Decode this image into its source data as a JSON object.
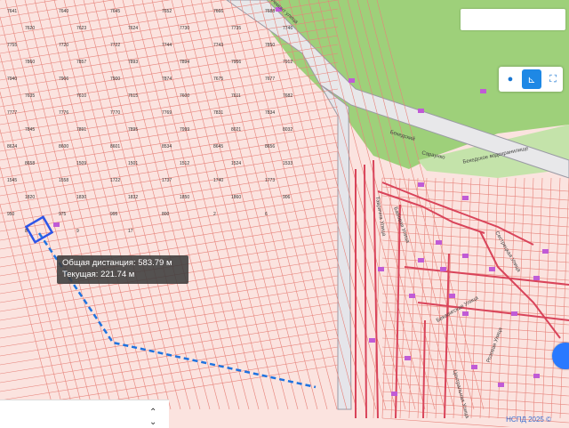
{
  "measure": {
    "total_label": "Общая дистанция: 583.79 м",
    "current_label": "Текущая: 221.74 м"
  },
  "streets": {
    "s1": "Ремонт улица",
    "s2": "Бекедский",
    "s3": "Сараунко",
    "s4": "Бекедское водохранилище",
    "s5": "Таврична Улица",
    "s6": "Сестрецкая Улица",
    "s7": "Бабовая Улица",
    "s8": "Бекаоигская Улица",
    "s9": "Розовая Улица",
    "s10": "Центральная Улица"
  },
  "parcels": [
    "7641",
    "7640",
    "7645",
    "7652",
    "7666",
    "7688",
    "7620",
    "7623",
    "7624",
    "7730",
    "7735",
    "7746",
    "7755",
    "7720",
    "7722",
    "7744",
    "7743",
    "7850",
    "7860",
    "7857",
    "7893",
    "7894",
    "7956",
    "7912",
    "7940",
    "7906",
    "7900",
    "7874",
    "7675",
    "7677",
    "7635",
    "7610",
    "7615",
    "7600",
    "7611",
    "7682",
    "7777",
    "7776",
    "7770",
    "7769",
    "7831",
    "7834",
    "7845",
    "7891",
    "7895",
    "7999",
    "8021",
    "8032",
    "8624",
    "8600",
    "8601",
    "8534",
    "8645",
    "8656",
    "8658",
    "1509",
    "1501",
    "1512",
    "1524",
    "1533",
    "1545",
    "1558",
    "1722",
    "1737",
    "1740",
    "1773",
    "1820",
    "1830",
    "1832",
    "1850",
    "1860",
    "906",
    "950",
    "975",
    "995",
    "800",
    "2",
    "6",
    "8",
    "9",
    "17"
  ],
  "copyright": "НСПД 2025 ©",
  "colors": {
    "parcel_fill": "#fbe3df",
    "parcel_line": "#e7837b",
    "selected_parcel": "#2c55e8",
    "route": "#1e73e0",
    "green": "#9ed07a",
    "building": "#c05bd6",
    "road_red": "#d9445a"
  },
  "icons": [
    "ruler-icon",
    "area-icon",
    "point-icon",
    "chevron-updown-icon",
    "locate-icon"
  ]
}
